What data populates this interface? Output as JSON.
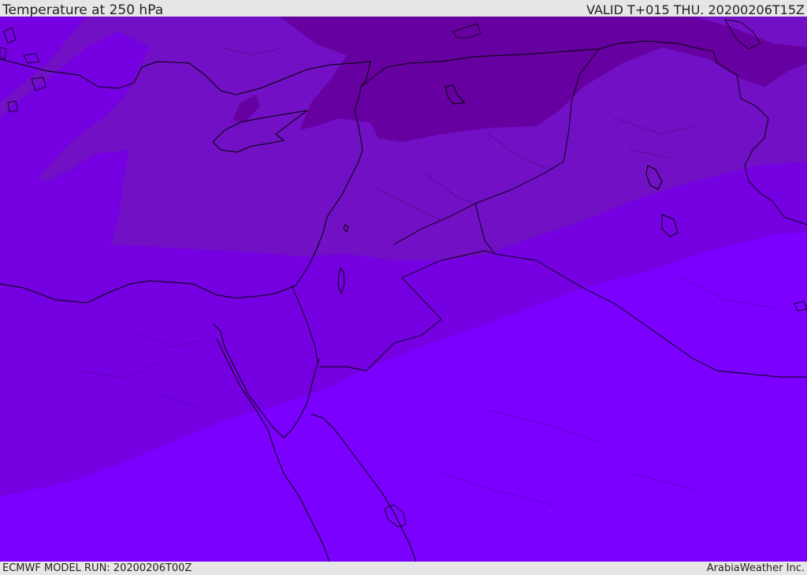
{
  "header": {
    "title": "Temperature at 250 hPa",
    "valid": "VALID T+015 THU. 20200206T15Z"
  },
  "footer": {
    "model_run": "ECMWF MODEL RUN: 20200206T00Z",
    "credit": "ArabiaWeather Inc."
  },
  "colors": {
    "band_warmest": "#7b00ff",
    "band_mid": "#7500e2",
    "band_cool": "#7110c4",
    "band_coldest": "#6700a0",
    "coastline": "#000000",
    "background": "#e6e6e6"
  }
}
